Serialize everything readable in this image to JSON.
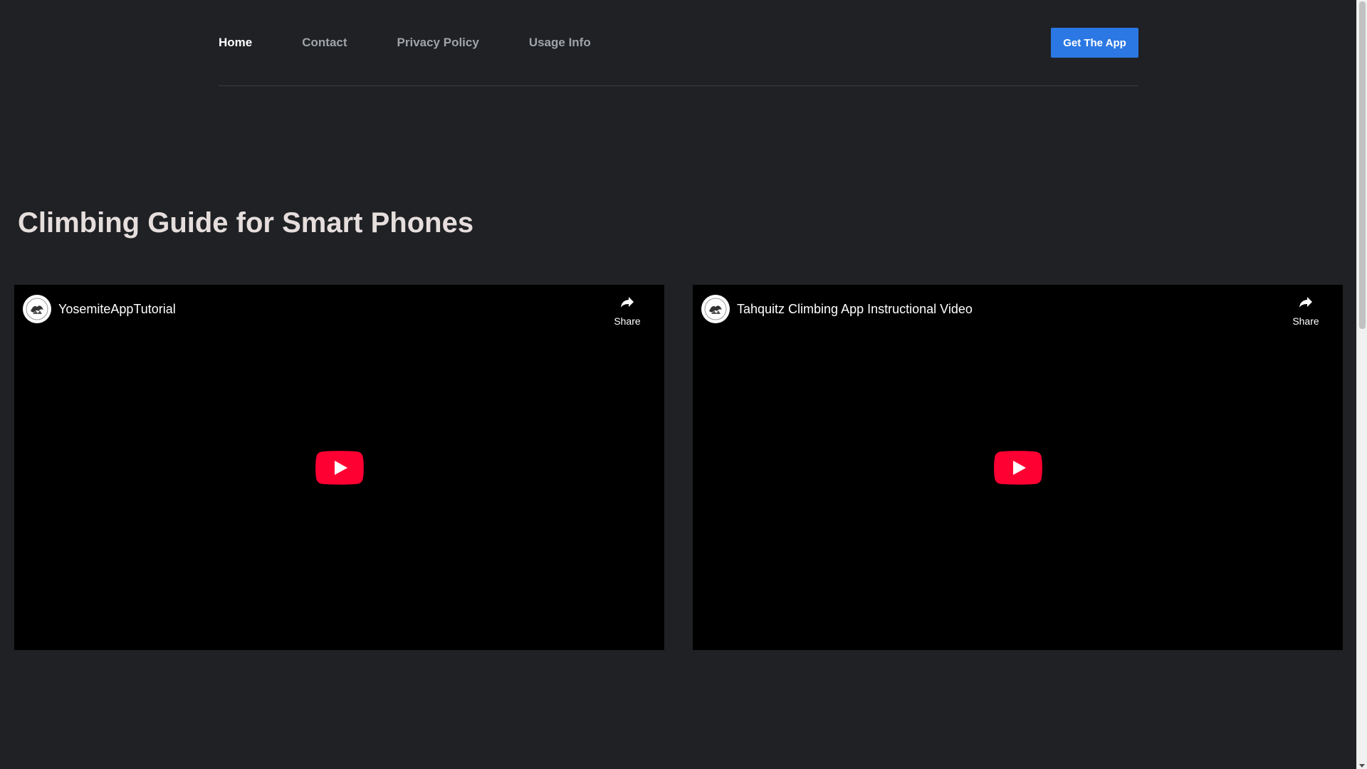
{
  "header": {
    "nav": [
      {
        "label": "Home",
        "active": true
      },
      {
        "label": "Contact",
        "active": false
      },
      {
        "label": "Privacy Policy",
        "active": false
      },
      {
        "label": "Usage Info",
        "active": false
      }
    ],
    "cta_label": "Get The App",
    "cta_color": "#2b78e4"
  },
  "hero": {
    "title": "Climbing Guide for Smart Phones"
  },
  "videos": [
    {
      "title": "YosemiteAppTutorial",
      "share_label": "Share",
      "avatar_icon": "channel-logo",
      "play_icon": "youtube-play-icon"
    },
    {
      "title": "Tahquitz Climbing App Instructional Video",
      "share_label": "Share",
      "avatar_icon": "channel-logo",
      "play_icon": "youtube-play-icon"
    }
  ],
  "colors": {
    "background": "#1f2124",
    "title_text": "#e6dedd",
    "nav_inactive": "#a0a4a8",
    "play_button": "#ff0033"
  }
}
